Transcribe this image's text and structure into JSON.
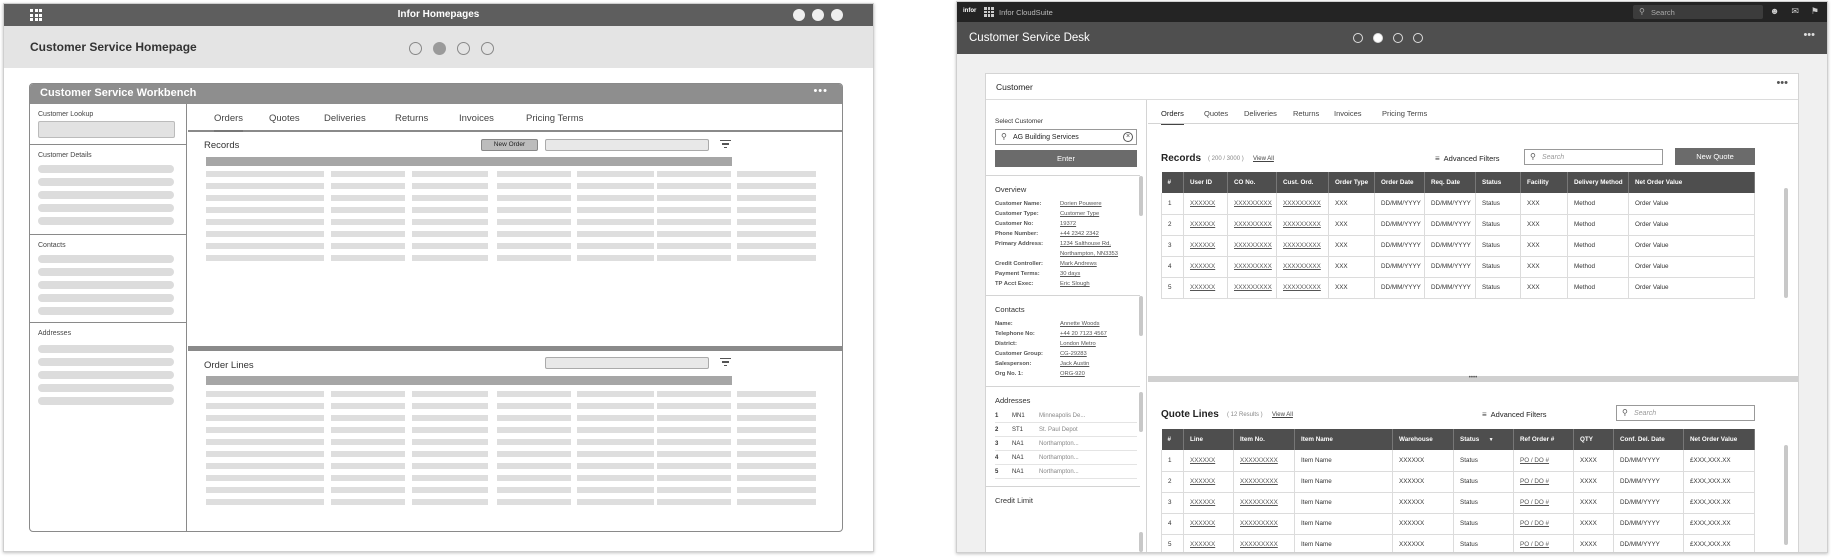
{
  "left": {
    "topbar": {
      "title": "Infor Homepages",
      "dots": 3
    },
    "header": {
      "title": "Customer Service Homepage"
    },
    "workbench": {
      "title": "Customer Service Workbench",
      "more": "•••",
      "sidebar": {
        "lookup_label": "Customer Lookup",
        "details_label": "Customer Details",
        "contacts_label": "Contacts",
        "addresses_label": "Addresses"
      },
      "tabs": [
        "Orders",
        "Quotes",
        "Deliveries",
        "Returns",
        "Invoices",
        "Pricing Terms"
      ],
      "records_title": "Records",
      "new_order_label": "New Order",
      "order_lines_title": "Order Lines"
    }
  },
  "right": {
    "topbar": {
      "logo": "infor",
      "brand": "Infor CloudSuite",
      "search_placeholder": "Search"
    },
    "header": {
      "title": "Customer Service Desk",
      "more": "•••"
    },
    "card": {
      "title": "Customer",
      "more": "•••",
      "select_customer_label": "Select Customer",
      "customer_value": "AG Building Services",
      "enter_label": "Enter",
      "overview": {
        "title": "Overview",
        "fields": [
          {
            "k": "Customer Name:",
            "v": "Dorien Pouwere"
          },
          {
            "k": "Customer Type:",
            "v": "Customer Type"
          },
          {
            "k": "Customer No:",
            "v": "19372"
          },
          {
            "k": "Phone Number:",
            "v": "+44 2342 2342"
          },
          {
            "k": "Primary Address:",
            "v": "1234 Salthouse Rd,"
          },
          {
            "k": "",
            "v": "Northampton, NN3353"
          },
          {
            "k": "Credit Controller:",
            "v": "Mark Andrews"
          },
          {
            "k": "Payment Terms:",
            "v": "30 days"
          },
          {
            "k": "TP Acct Exec:",
            "v": "Eric Slough"
          }
        ]
      },
      "contacts": {
        "title": "Contacts",
        "fields": [
          {
            "k": "Name:",
            "v": "Annette Woods"
          },
          {
            "k": "Telephone No:",
            "v": "+44 20 7123 4567"
          },
          {
            "k": "District:",
            "v": "London Metro"
          },
          {
            "k": "Customer Group:",
            "v": "CG-29283"
          },
          {
            "k": "Salesperson:",
            "v": "Jack Austin"
          },
          {
            "k": "Org No. 1:",
            "v": "ORG-920"
          }
        ]
      },
      "addresses": {
        "title": "Addresses",
        "items": [
          {
            "n": "1",
            "c": "MN1",
            "p": "Minneapolis De..."
          },
          {
            "n": "2",
            "c": "ST1",
            "p": "St. Paul Depot"
          },
          {
            "n": "3",
            "c": "NA1",
            "p": "Northampton..."
          },
          {
            "n": "4",
            "c": "NA1",
            "p": "Northampton..."
          },
          {
            "n": "5",
            "c": "NA1",
            "p": "Northampton..."
          }
        ]
      },
      "credit_limit_title": "Credit Limit",
      "tabs": [
        "Orders",
        "Quotes",
        "Deliveries",
        "Returns",
        "Invoices",
        "Pricing Terms"
      ],
      "records": {
        "title": "Records",
        "count": "( 200 / 3000 )",
        "view_all": "View All",
        "advanced_filters": "Advanced Filters",
        "search_placeholder": "Search",
        "new_quote": "New Quote",
        "columns": [
          "#",
          "User ID",
          "CO No.",
          "Cust. Ord.",
          "Order Type",
          "Order Date",
          "Req. Date",
          "Status",
          "Facility",
          "Delivery Method",
          "Net Order Value"
        ],
        "rows": [
          [
            "1",
            "XXXXXX",
            "XXXXXXXXX",
            "XXXXXXXXX",
            "XXX",
            "DD/MM/YYYY",
            "DD/MM/YYYY",
            "Status",
            "XXX",
            "Method",
            "Order Value"
          ],
          [
            "2",
            "XXXXXX",
            "XXXXXXXXX",
            "XXXXXXXXX",
            "XXX",
            "DD/MM/YYYY",
            "DD/MM/YYYY",
            "Status",
            "XXX",
            "Method",
            "Order Value"
          ],
          [
            "3",
            "XXXXXX",
            "XXXXXXXXX",
            "XXXXXXXXX",
            "XXX",
            "DD/MM/YYYY",
            "DD/MM/YYYY",
            "Status",
            "XXX",
            "Method",
            "Order Value"
          ],
          [
            "4",
            "XXXXXX",
            "XXXXXXXXX",
            "XXXXXXXXX",
            "XXX",
            "DD/MM/YYYY",
            "DD/MM/YYYY",
            "Status",
            "XXX",
            "Method",
            "Order Value"
          ],
          [
            "5",
            "XXXXXX",
            "XXXXXXXXX",
            "XXXXXXXXX",
            "XXX",
            "DD/MM/YYYY",
            "DD/MM/YYYY",
            "Status",
            "XXX",
            "Method",
            "Order Value"
          ]
        ]
      },
      "divider_handle": "••••",
      "quote_lines": {
        "title": "Quote Lines",
        "count": "( 12 Results )",
        "view_all": "View All",
        "advanced_filters": "Advanced Filters",
        "search_placeholder": "Search",
        "columns": [
          "#",
          "Line",
          "Item No.",
          "Item Name",
          "Warehouse",
          "Status",
          "Ref Order #",
          "QTY",
          "Conf. Del. Date",
          "Net Order Value"
        ],
        "rows": [
          [
            "1",
            "XXXXXX",
            "XXXXXXXXX",
            "Item Name",
            "XXXXXX",
            "Status",
            "PO / DO #",
            "XXXX",
            "DD/MM/YYYY",
            "£XXX,XXX.XX"
          ],
          [
            "2",
            "XXXXXX",
            "XXXXXXXXX",
            "Item Name",
            "XXXXXX",
            "Status",
            "PO / DO #",
            "XXXX",
            "DD/MM/YYYY",
            "£XXX,XXX.XX"
          ],
          [
            "3",
            "XXXXXX",
            "XXXXXXXXX",
            "Item Name",
            "XXXXXX",
            "Status",
            "PO / DO #",
            "XXXX",
            "DD/MM/YYYY",
            "£XXX,XXX.XX"
          ],
          [
            "4",
            "XXXXXX",
            "XXXXXXXXX",
            "Item Name",
            "XXXXXX",
            "Status",
            "PO / DO #",
            "XXXX",
            "DD/MM/YYYY",
            "£XXX,XXX.XX"
          ],
          [
            "5",
            "XXXXXX",
            "XXXXXXXXX",
            "Item Name",
            "XXXXXX",
            "Status",
            "PO / DO #",
            "XXXX",
            "DD/MM/YYYY",
            "£XXX,XXX.XX"
          ]
        ]
      }
    }
  }
}
